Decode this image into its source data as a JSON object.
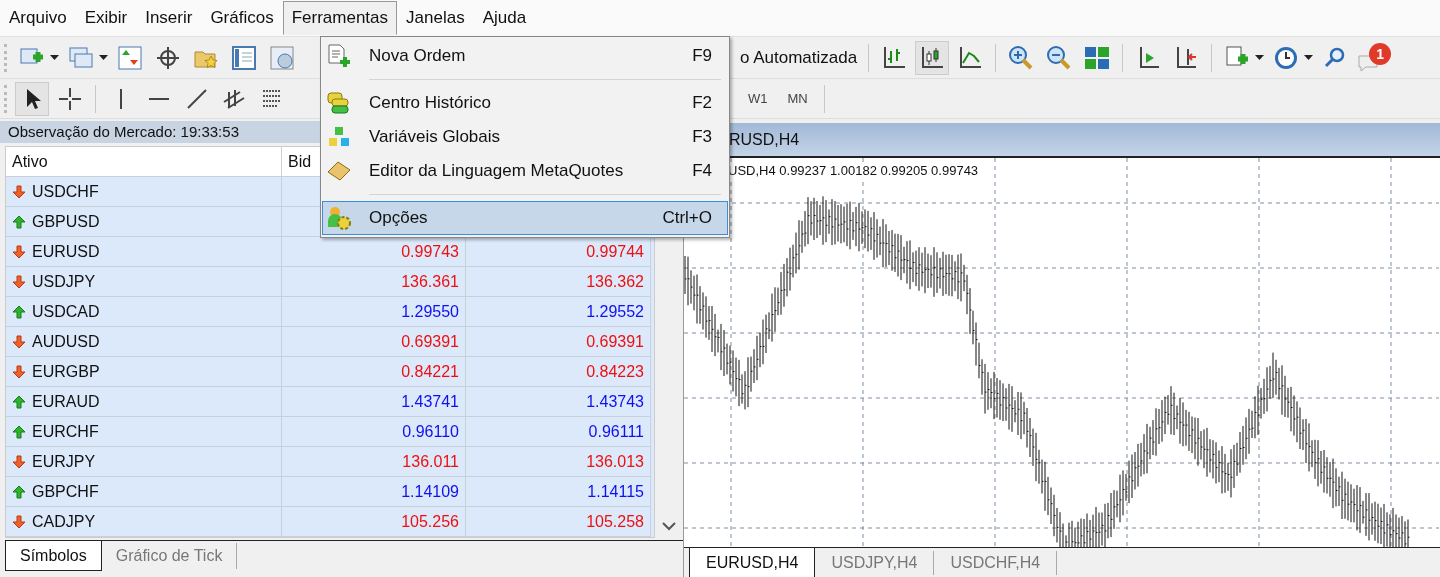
{
  "menu_bar": [
    {
      "label": "Arquivo",
      "selected": false
    },
    {
      "label": "Exibir",
      "selected": false
    },
    {
      "label": "Inserir",
      "selected": false
    },
    {
      "label": "Gráficos",
      "selected": false
    },
    {
      "label": "Ferramentas",
      "selected": true
    },
    {
      "label": "Janelas",
      "selected": false
    },
    {
      "label": "Ajuda",
      "selected": false
    }
  ],
  "dropdown_menu": [
    {
      "kind": "item",
      "label": "Nova Ordem",
      "shortcut": "F9",
      "selected": false
    },
    {
      "kind": "separator"
    },
    {
      "kind": "item",
      "label": "Centro Histórico",
      "shortcut": "F2",
      "selected": false
    },
    {
      "kind": "item",
      "label": "Variáveis Globais",
      "shortcut": "F3",
      "selected": false
    },
    {
      "kind": "item",
      "label": "Editor da Linguagem MetaQuotes",
      "shortcut": "F4",
      "selected": false
    },
    {
      "kind": "separator"
    },
    {
      "kind": "item",
      "label": "Opções",
      "shortcut": "Ctrl+O",
      "selected": true
    }
  ],
  "toolbar": {
    "auto_trading_button": "o Automatizada",
    "notification_badge": "1"
  },
  "timeframes": [
    "W1",
    "MN"
  ],
  "market_watch": {
    "title": "Observação do Mercado: 19:33:53",
    "columns": [
      "Ativo",
      "Bid"
    ],
    "rows": [
      {
        "symbol": "USDCHF",
        "kind": "down"
      },
      {
        "symbol": "GBPUSD",
        "kind": "up"
      },
      {
        "symbol": "EURUSD",
        "kind": "down",
        "bid": "0.99743",
        "ask": "0.99744"
      },
      {
        "symbol": "USDJPY",
        "kind": "down",
        "bid": "136.361",
        "ask": "136.362"
      },
      {
        "symbol": "USDCAD",
        "kind": "up",
        "bid": "1.29550",
        "ask": "1.29552"
      },
      {
        "symbol": "AUDUSD",
        "kind": "down",
        "bid": "0.69391",
        "ask": "0.69391"
      },
      {
        "symbol": "EURGBP",
        "kind": "down",
        "bid": "0.84221",
        "ask": "0.84223"
      },
      {
        "symbol": "EURAUD",
        "kind": "up",
        "bid": "1.43741",
        "ask": "1.43743"
      },
      {
        "symbol": "EURCHF",
        "kind": "up",
        "bid": "0.96110",
        "ask": "0.96111"
      },
      {
        "symbol": "EURJPY",
        "kind": "down",
        "bid": "136.011",
        "ask": "136.013"
      },
      {
        "symbol": "GBPCHF",
        "kind": "up",
        "bid": "1.14109",
        "ask": "1.14115"
      },
      {
        "symbol": "CADJPY",
        "kind": "down",
        "bid": "105.256",
        "ask": "105.258"
      }
    ],
    "tabs": [
      {
        "label": "Símbolos",
        "selected": true
      },
      {
        "label": "Gráfico de Tick",
        "selected": false
      }
    ]
  },
  "chart": {
    "title": "RUSD,H4",
    "info": "USD,H4  0.99237 1.00182 0.99205 0.99743",
    "tabs": [
      {
        "label": "EURUSD,H4",
        "selected": true
      },
      {
        "label": "USDJPY,H4",
        "selected": false
      },
      {
        "label": "USDCHF,H4",
        "selected": false
      }
    ]
  }
}
